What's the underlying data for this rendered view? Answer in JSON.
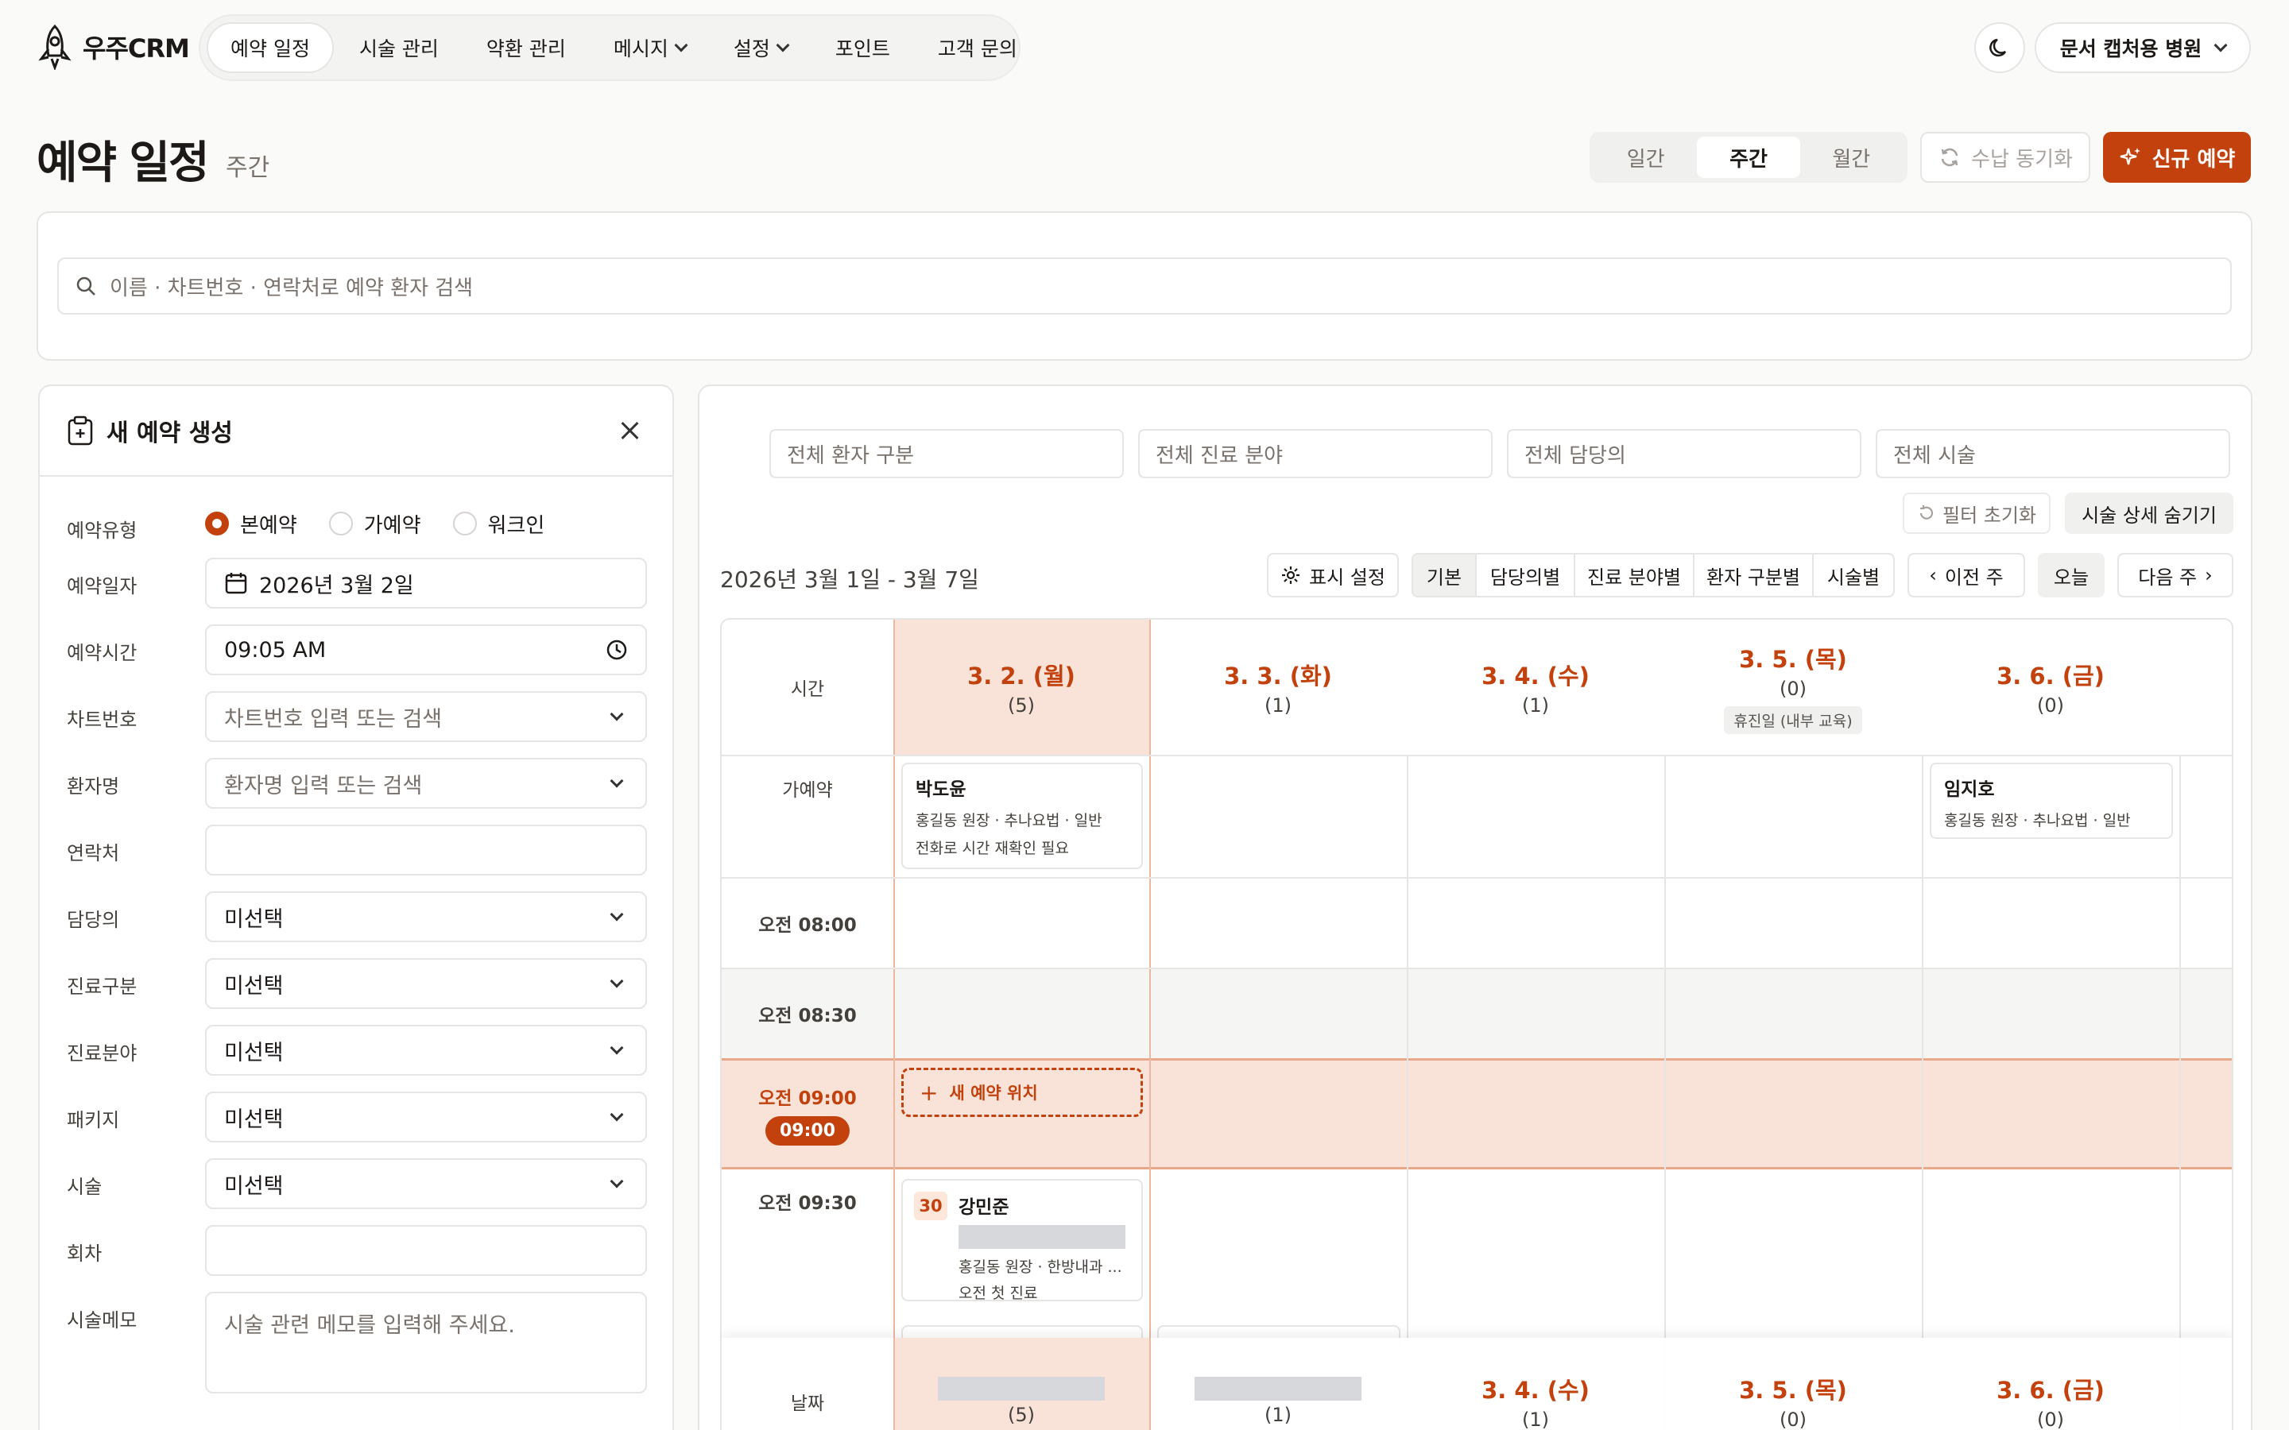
{
  "app": {
    "name": "우주CRM"
  },
  "nav": {
    "items": [
      {
        "label": "예약 일정",
        "active": true,
        "dropdown": false
      },
      {
        "label": "시술 관리",
        "active": false,
        "dropdown": false
      },
      {
        "label": "약환 관리",
        "active": false,
        "dropdown": false
      },
      {
        "label": "메시지",
        "active": false,
        "dropdown": true
      },
      {
        "label": "설정",
        "active": false,
        "dropdown": true
      },
      {
        "label": "포인트",
        "active": false,
        "dropdown": false
      },
      {
        "label": "고객 문의",
        "active": false,
        "dropdown": false
      }
    ],
    "clinic": "문서 캡처용 병원"
  },
  "page": {
    "title": "예약 일정",
    "subtitle": "주간",
    "views": [
      "일간",
      "주간",
      "월간"
    ],
    "active_view": "주간",
    "sync_label": "수납 동기화",
    "new_label": "신규 예약"
  },
  "search": {
    "placeholder": "이름 · 차트번호 · 연락처로 예약 환자 검색"
  },
  "form": {
    "title": "새 예약 생성",
    "type_label": "예약유형",
    "types": [
      "본예약",
      "가예약",
      "워크인"
    ],
    "selected_type": "본예약",
    "date_label": "예약일자",
    "date_value": "2026년 3월 2일",
    "time_label": "예약시간",
    "time_value": "09:05 AM",
    "chart_label": "차트번호",
    "chart_placeholder": "차트번호 입력 또는 검색",
    "name_label": "환자명",
    "name_placeholder": "환자명 입력 또는 검색",
    "phone_label": "연락처",
    "doctor_label": "담당의",
    "doctor_value": "미선택",
    "category_label": "진료구분",
    "category_value": "미선택",
    "field_label": "진료분야",
    "field_value": "미선택",
    "package_label": "패키지",
    "package_value": "미선택",
    "procedure_label": "시술",
    "procedure_value": "미선택",
    "session_label": "회차",
    "memo_label": "시술메모",
    "memo_placeholder": "시술 관련 메모를 입력해 주세요."
  },
  "calendar": {
    "filters": [
      "전체 환자 구분",
      "전체 진료 분야",
      "전체 담당의",
      "전체 시술"
    ],
    "reset_label": "필터 초기화",
    "hide_detail_label": "시술 상세 숨기기",
    "range": "2026년 3월 1일 - 3월 7일",
    "display_settings": "표시 설정",
    "group_modes": [
      "기본",
      "담당의별",
      "진료 분야별",
      "환자 구분별",
      "시술별"
    ],
    "active_mode": "기본",
    "prev_label": "이전 주",
    "today_label": "오늘",
    "next_label": "다음 주",
    "time_header": "시간",
    "days": [
      {
        "date": "3. 2. (월)",
        "count": "(5)",
        "today": true
      },
      {
        "date": "3. 3. (화)",
        "count": "(1)"
      },
      {
        "date": "3. 4. (수)",
        "count": "(1)"
      },
      {
        "date": "3. 5. (목)",
        "count": "(0)",
        "holiday": "휴진일 (내부 교육)"
      },
      {
        "date": "3. 6. (금)",
        "count": "(0)"
      }
    ],
    "rows": {
      "tentative": "가예약",
      "t0800": "오전 08:00",
      "t0830": "오전 08:30",
      "t0900": "오전 09:00",
      "now_badge": "09:00",
      "t0930": "오전 09:30"
    },
    "new_slot_label": "새 예약 위치",
    "appointments": {
      "a1": {
        "name": "박도윤",
        "line1": "홍길동 원장 · 추나요법 · 일반",
        "line2": "전화로 시간 재확인 필요"
      },
      "a2": {
        "name": "임지호",
        "line1": "홍길동 원장 · 추나요법 · 일반"
      },
      "a3": {
        "duration": "30",
        "name": "강민준",
        "line1": "홍길동 원장 · 한방내과 ...",
        "line2": "오전 첫 진료"
      }
    },
    "footer": {
      "label": "날짜",
      "days": [
        {
          "date": "",
          "count": "(5)"
        },
        {
          "date": "",
          "count": "(1)"
        },
        {
          "date": "3. 4. (수)",
          "count": "(1)"
        },
        {
          "date": "3. 5. (목)",
          "count": "(0)"
        },
        {
          "date": "3. 6. (금)",
          "count": "(0)"
        }
      ]
    }
  },
  "colors": {
    "accent": "#c2410c",
    "accent_soft": "#f9e3d8"
  }
}
